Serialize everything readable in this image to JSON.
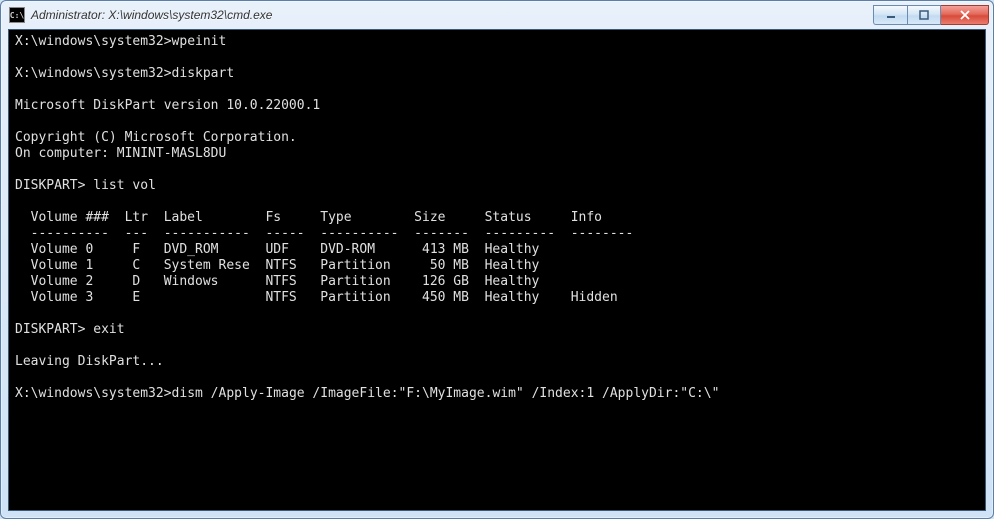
{
  "title": "Administrator: X:\\windows\\system32\\cmd.exe",
  "terminal": {
    "prompt1": "X:\\windows\\system32>",
    "cmd1": "wpeinit",
    "prompt2": "X:\\windows\\system32>",
    "cmd2": "diskpart",
    "dp_version": "Microsoft DiskPart version 10.0.22000.1",
    "dp_copyright": "Copyright (C) Microsoft Corporation.",
    "dp_computer": "On computer: MININT-MASL8DU",
    "dp_prompt1": "DISKPART>",
    "dp_cmd1": "list vol",
    "header": "  Volume ###  Ltr  Label        Fs     Type        Size     Status     Info",
    "divider": "  ----------  ---  -----------  -----  ----------  -------  ---------  --------",
    "row0": "  Volume 0     F   DVD_ROM      UDF    DVD-ROM      413 MB  Healthy",
    "row1": "  Volume 1     C   System Rese  NTFS   Partition     50 MB  Healthy",
    "row2": "  Volume 2     D   Windows      NTFS   Partition    126 GB  Healthy",
    "row3": "  Volume 3     E                NTFS   Partition    450 MB  Healthy    Hidden",
    "dp_prompt2": "DISKPART>",
    "dp_cmd2": "exit",
    "dp_leaving": "Leaving DiskPart...",
    "prompt3": "X:\\windows\\system32>",
    "cmd3": "dism /Apply-Image /ImageFile:\"F:\\MyImage.wim\" /Index:1 /ApplyDir:\"C:\\\""
  }
}
